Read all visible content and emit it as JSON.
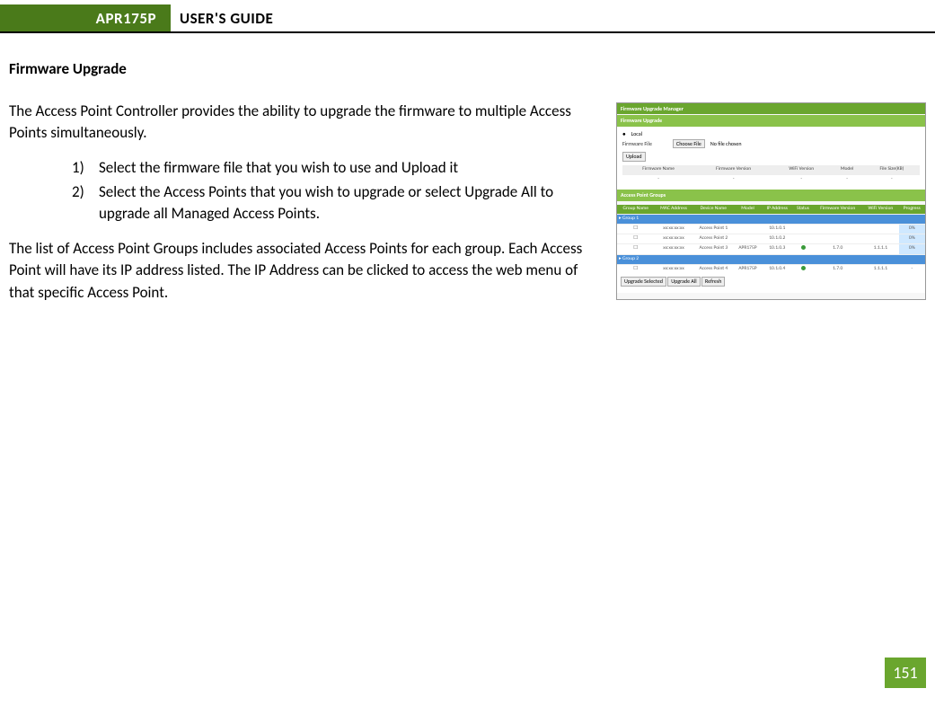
{
  "header": {
    "badge": "APR175P",
    "title": "USER'S GUIDE"
  },
  "section_title": "Firmware Upgrade",
  "para1": "The Access Point Controller provides the ability to upgrade the firmware to multiple Access Points simultaneously.",
  "list": [
    {
      "num": "1)",
      "text": "Select the firmware file that you wish to use and Upload it"
    },
    {
      "num": "2)",
      "text": "Select the Access Points that you wish to upgrade or select Upgrade All to upgrade all Managed Access Points."
    }
  ],
  "para2": "The list of Access Point Groups includes associated Access Points for each group.  Each Access Point will have its IP address listed.  The IP Address can be clicked to access the web menu of that specific Access Point.",
  "page_number": "151",
  "screenshot": {
    "title_bar": "Firmware Upgrade Manager",
    "panel1": "Firmware Upgrade",
    "row_local": "Local",
    "row_file": "Firmware File",
    "choose_btn": "Choose File",
    "no_file": "No file chosen",
    "upload_btn": "Upload",
    "table1_headers": [
      "Firmware Name",
      "Firmware Version",
      "WiFi Version",
      "Model",
      "File Size(KB)"
    ],
    "panel2": "Access Point Groups",
    "table2_headers": [
      "Group Name",
      "MAC Address",
      "Device Name",
      "Model",
      "IP Address",
      "Status",
      "Firmware Version",
      "WiFi Version",
      "Progress"
    ],
    "buttons": [
      "Upgrade Selected",
      "Upgrade All",
      "Refresh"
    ]
  }
}
